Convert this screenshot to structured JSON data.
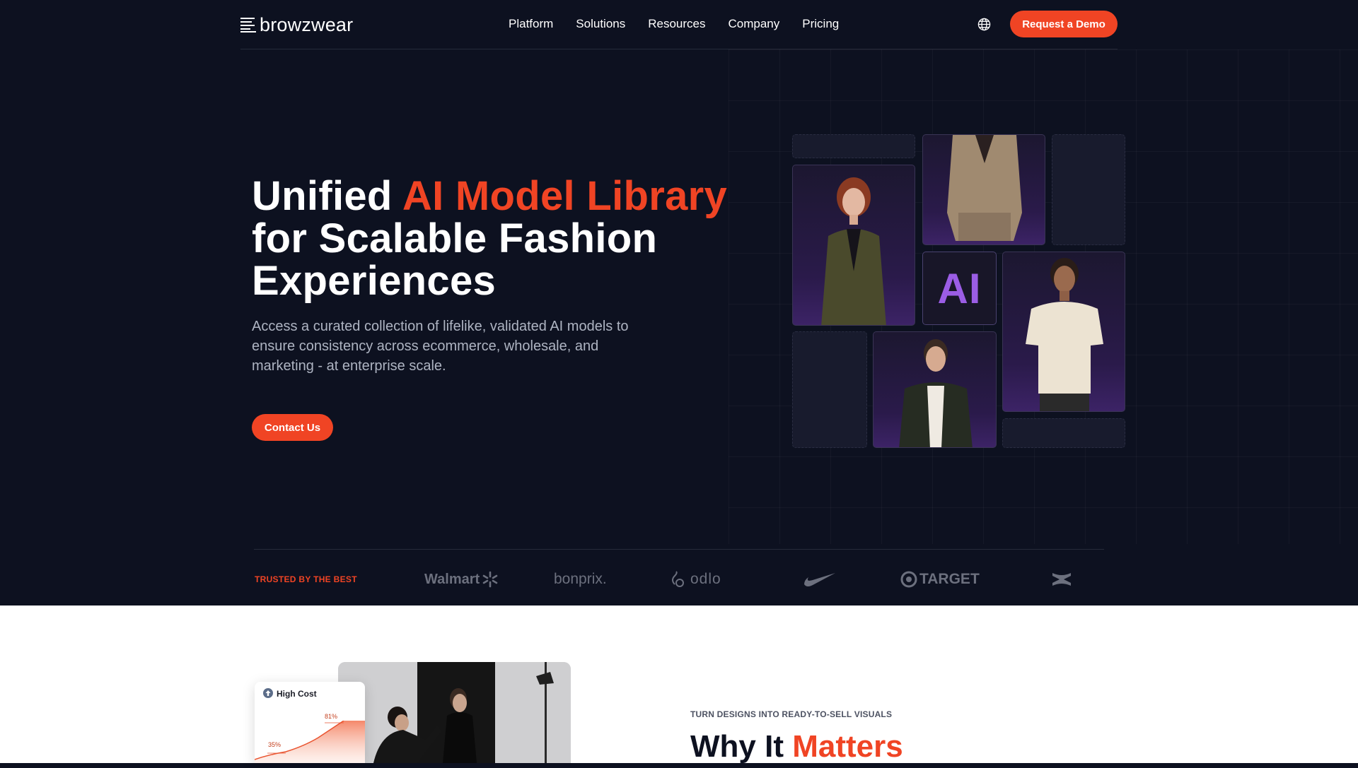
{
  "header": {
    "logo_text": "browzwear",
    "nav": [
      "Platform",
      "Solutions",
      "Resources",
      "Company",
      "Pricing"
    ],
    "cta": "Request a Demo"
  },
  "hero": {
    "title_pre": "Unified ",
    "title_accent": "AI Model Library",
    "title_post": "for Scalable Fashion Experiences",
    "subtitle": "Access a curated collection of lifelike, validated AI models to ensure consistency across ecommerce, wholesale, and marketing - at enterprise scale.",
    "cta": "Contact Us",
    "ai_tile": "AI"
  },
  "trusted": {
    "label": "TRUSTED BY THE BEST",
    "brands": [
      "Walmart",
      "bonprix.",
      "odlo",
      "Nike",
      "TARGET",
      "Under Armour"
    ]
  },
  "section2": {
    "card_title": "High Cost",
    "card_values": [
      "81%",
      "35%"
    ],
    "kicker": "TURN DESIGNS INTO READY-TO-SELL VISUALS",
    "title_pre": "Why It ",
    "title_accent": "Matters"
  },
  "colors": {
    "accent": "#f04424",
    "background": "#0d1120",
    "ai_purple": "#9b5de5"
  },
  "icons": [
    "logo-icon",
    "globe-icon",
    "arrow-up-icon"
  ]
}
